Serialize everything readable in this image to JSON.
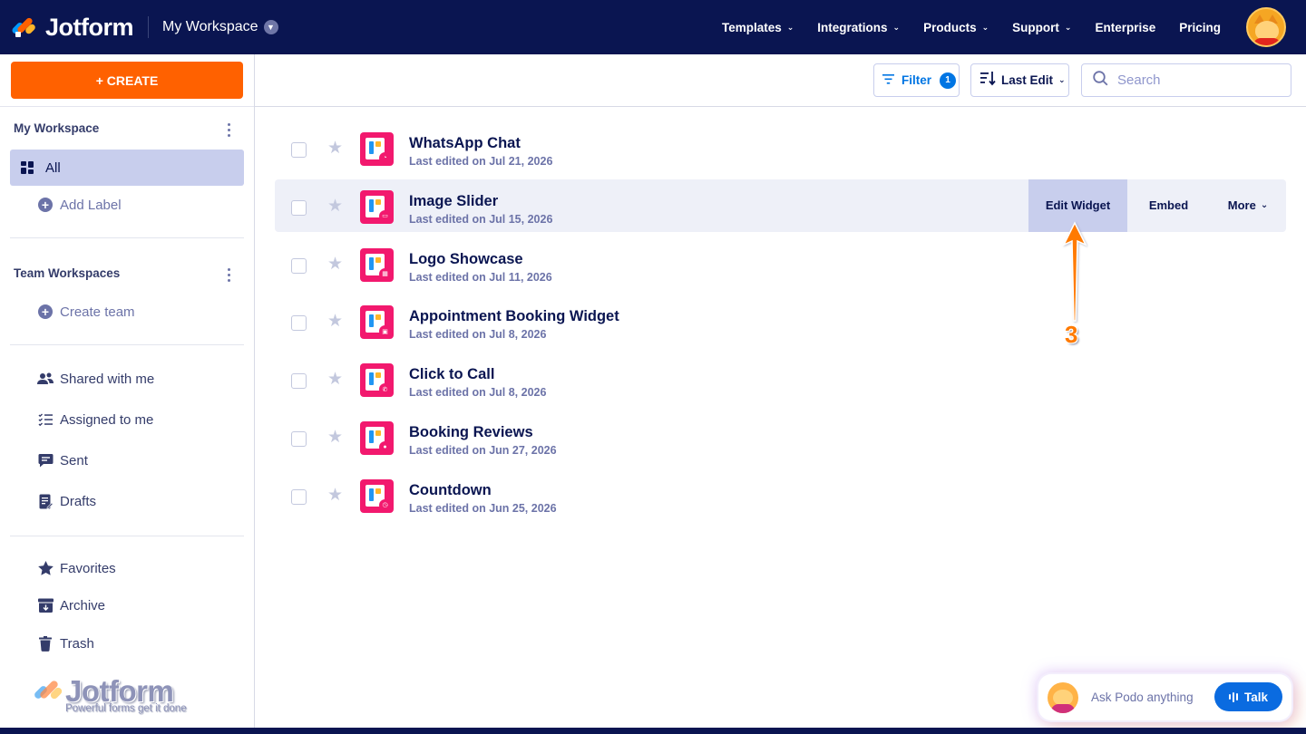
{
  "topbar": {
    "brand": "Jotform",
    "workspace": "My Workspace",
    "nav": [
      {
        "label": "Templates",
        "has_menu": true
      },
      {
        "label": "Integrations",
        "has_menu": true
      },
      {
        "label": "Products",
        "has_menu": true
      },
      {
        "label": "Support",
        "has_menu": true
      },
      {
        "label": "Enterprise",
        "has_menu": false
      },
      {
        "label": "Pricing",
        "has_menu": false
      }
    ]
  },
  "sidebar": {
    "create_label": "+ CREATE",
    "my_workspace": {
      "title": "My Workspace",
      "items": [
        {
          "label": "All",
          "icon": "grid-icon",
          "active": true
        },
        {
          "label": "Add Label",
          "icon": "plus-circle-icon",
          "active": false
        }
      ]
    },
    "team_workspaces": {
      "title": "Team Workspaces",
      "items": [
        {
          "label": "Create team",
          "icon": "plus-circle-icon"
        }
      ]
    },
    "inbox_items": [
      {
        "label": "Shared with me",
        "icon": "users-icon"
      },
      {
        "label": "Assigned to me",
        "icon": "checklist-icon"
      },
      {
        "label": "Sent",
        "icon": "message-icon"
      },
      {
        "label": "Drafts",
        "icon": "draft-icon"
      }
    ],
    "other_items": [
      {
        "label": "Favorites",
        "icon": "star-icon"
      },
      {
        "label": "Archive",
        "icon": "archive-icon"
      },
      {
        "label": "Trash",
        "icon": "trash-icon"
      }
    ],
    "footer_logo": {
      "name": "Jotform",
      "tagline": "Powerful forms get it done"
    }
  },
  "toolbar": {
    "filter_label": "Filter",
    "filter_count": "1",
    "sort_label": "Last Edit",
    "search_placeholder": "Search"
  },
  "forms": [
    {
      "title": "WhatsApp Chat",
      "meta": "Last edited on Jul 21, 2026",
      "badge_icon": "whatsapp-icon"
    },
    {
      "title": "Image Slider",
      "meta": "Last edited on Jul 15, 2026",
      "badge_icon": "image-icon",
      "hovered": true
    },
    {
      "title": "Logo Showcase",
      "meta": "Last edited on Jul 11, 2026",
      "badge_icon": "grid-icon"
    },
    {
      "title": "Appointment Booking Widget",
      "meta": "Last edited on Jul 8, 2026",
      "badge_icon": "calendar-icon"
    },
    {
      "title": "Click to Call",
      "meta": "Last edited on Jul 8, 2026",
      "badge_icon": "phone-icon"
    },
    {
      "title": "Booking Reviews",
      "meta": "Last edited on Jun 27, 2026",
      "badge_icon": "booking-icon"
    },
    {
      "title": "Countdown",
      "meta": "Last edited on Jun 25, 2026",
      "badge_icon": "clock-icon"
    }
  ],
  "row_actions": {
    "edit_label": "Edit Widget",
    "embed_label": "Embed",
    "more_label": "More"
  },
  "annotation": {
    "step": "3",
    "color": "#ff7a00"
  },
  "podo": {
    "prompt": "Ask Podo anything",
    "talk_label": "Talk"
  },
  "colors": {
    "navy": "#0a1551",
    "orange": "#ff6100",
    "blue": "#0075e3",
    "pink": "#f2196e",
    "active_bg": "#c8ceed"
  }
}
